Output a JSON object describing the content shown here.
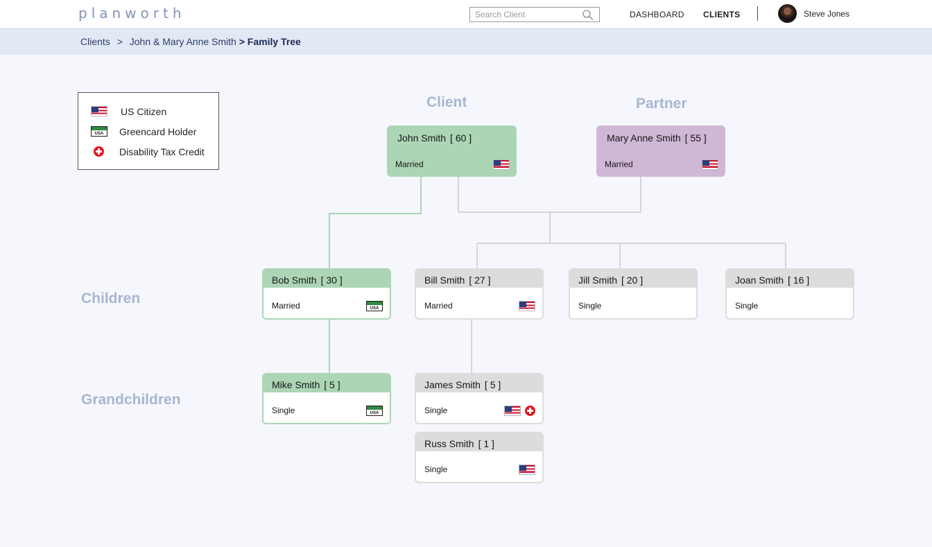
{
  "header": {
    "logo": "planworth",
    "search_placeholder": "Search Client",
    "nav": {
      "dashboard": "DASHBOARD",
      "clients": "CLIENTS"
    },
    "user_name": "Steve Jones"
  },
  "breadcrumb": {
    "root": "Clients",
    "separator": ">",
    "client": "John & Mary Anne Smith",
    "current": "> Family Tree"
  },
  "legend": {
    "us_citizen": "US Citizen",
    "greencard": "Greencard Holder",
    "greencard_text": "USA",
    "disability": "Disability Tax Credit"
  },
  "sections": {
    "client": "Client",
    "partner": "Partner",
    "children": "Children",
    "grandchildren": "Grandchildren"
  },
  "people": {
    "john": {
      "name": "John Smith",
      "age": "[ 60 ]",
      "status": "Married",
      "icons": [
        "us-flag-icon"
      ]
    },
    "mary": {
      "name": "Mary Anne Smith",
      "age": "[ 55 ]",
      "status": "Married",
      "icons": [
        "us-flag-icon"
      ]
    },
    "bob": {
      "name": "Bob Smith",
      "age": "[ 30 ]",
      "status": "Married",
      "icons": [
        "greencard-icon"
      ]
    },
    "bill": {
      "name": "Bill Smith",
      "age": "[ 27 ]",
      "status": "Married",
      "icons": [
        "us-flag-icon"
      ]
    },
    "jill": {
      "name": "Jill Smith",
      "age": "[ 20 ]",
      "status": "Single",
      "icons": []
    },
    "joan": {
      "name": "Joan Smith",
      "age": "[ 16 ]",
      "status": "Single",
      "icons": []
    },
    "mike": {
      "name": "Mike Smith",
      "age": "[ 5 ]",
      "status": "Single",
      "icons": [
        "greencard-icon"
      ]
    },
    "james": {
      "name": "James Smith",
      "age": "[ 5 ]",
      "status": "Single",
      "icons": [
        "us-flag-icon",
        "disability-icon"
      ]
    },
    "russ": {
      "name": "Russ Smith",
      "age": "[ 1 ]",
      "status": "Single",
      "icons": [
        "us-flag-icon"
      ]
    }
  },
  "colors": {
    "client_card": "#acd5b6",
    "partner_card": "#cfb7d6",
    "default_card_header": "#dcdcdc",
    "section_label": "#a8b6d1",
    "connector_green": "#acd5b6",
    "connector_gray": "#d5d5d5"
  }
}
